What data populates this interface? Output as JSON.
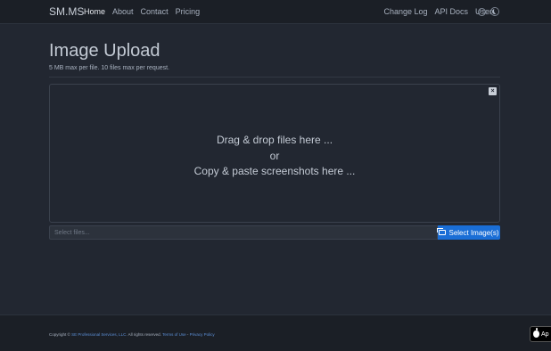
{
  "navbar": {
    "brand": "SM.MS",
    "left_links": [
      "Home",
      "About",
      "Contact",
      "Pricing"
    ],
    "right_links": [
      "Change Log",
      "API Docs"
    ],
    "user_menu": "User"
  },
  "header": {
    "title": "Image Upload",
    "subtitle": "5 MB max per file. 10 files max per request."
  },
  "dropzone": {
    "close_glyph": "×",
    "line1": "Drag & drop files here ...",
    "line2": "or",
    "line3": "Copy & paste screenshots here ..."
  },
  "file_input": {
    "placeholder": "Select files..."
  },
  "select_button": {
    "label": "Select Image(s)"
  },
  "footer": {
    "copyright_prefix": "Copyright ©",
    "company": "SE Professional Services, LLC.",
    "rights": "All rights reserved.",
    "terms": "Terms of Use",
    "separator": "-",
    "privacy": "Privacy Policy"
  },
  "app_badge": {
    "label": "Ap"
  },
  "colors": {
    "background": "#222731",
    "navbar": "#1b1f26",
    "accent": "#1a6ed6",
    "link": "#5c8fd6"
  }
}
